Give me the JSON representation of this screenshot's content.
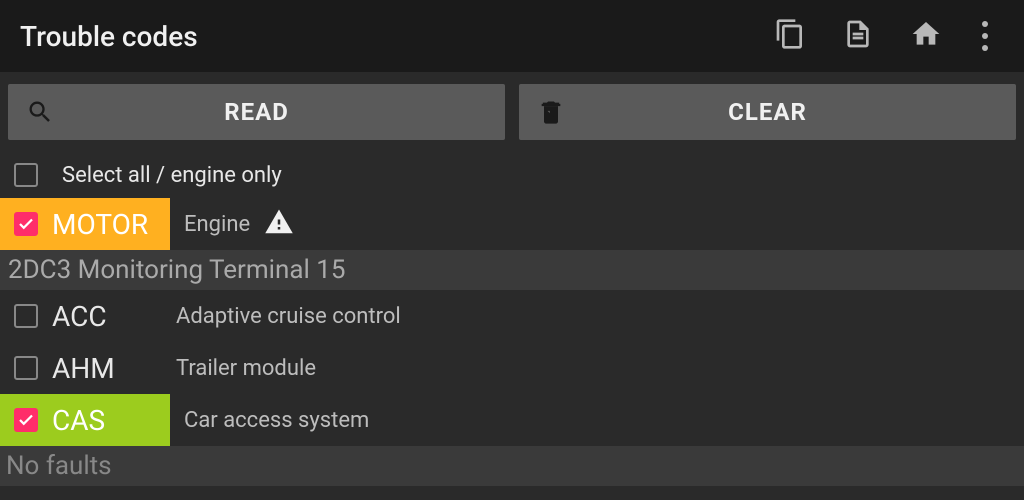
{
  "topbar": {
    "title": "Trouble codes"
  },
  "actions": {
    "read_label": "READ",
    "clear_label": "CLEAR"
  },
  "select_all": {
    "label": "Select all / engine only",
    "checked": false
  },
  "modules": [
    {
      "code": "MOTOR",
      "name": "Engine",
      "checked": true,
      "highlight": "motor",
      "has_warning": true,
      "faults": [
        "2DC3 Monitoring Terminal 15"
      ]
    },
    {
      "code": "ACC",
      "name": "Adaptive cruise control",
      "checked": false,
      "highlight": null,
      "has_warning": false,
      "faults": []
    },
    {
      "code": "AHM",
      "name": "Trailer module",
      "checked": false,
      "highlight": null,
      "has_warning": false,
      "faults": []
    },
    {
      "code": "CAS",
      "name": "Car access system",
      "checked": true,
      "highlight": "cas",
      "has_warning": false,
      "faults": []
    }
  ],
  "footer": {
    "no_faults_label": "No faults"
  }
}
